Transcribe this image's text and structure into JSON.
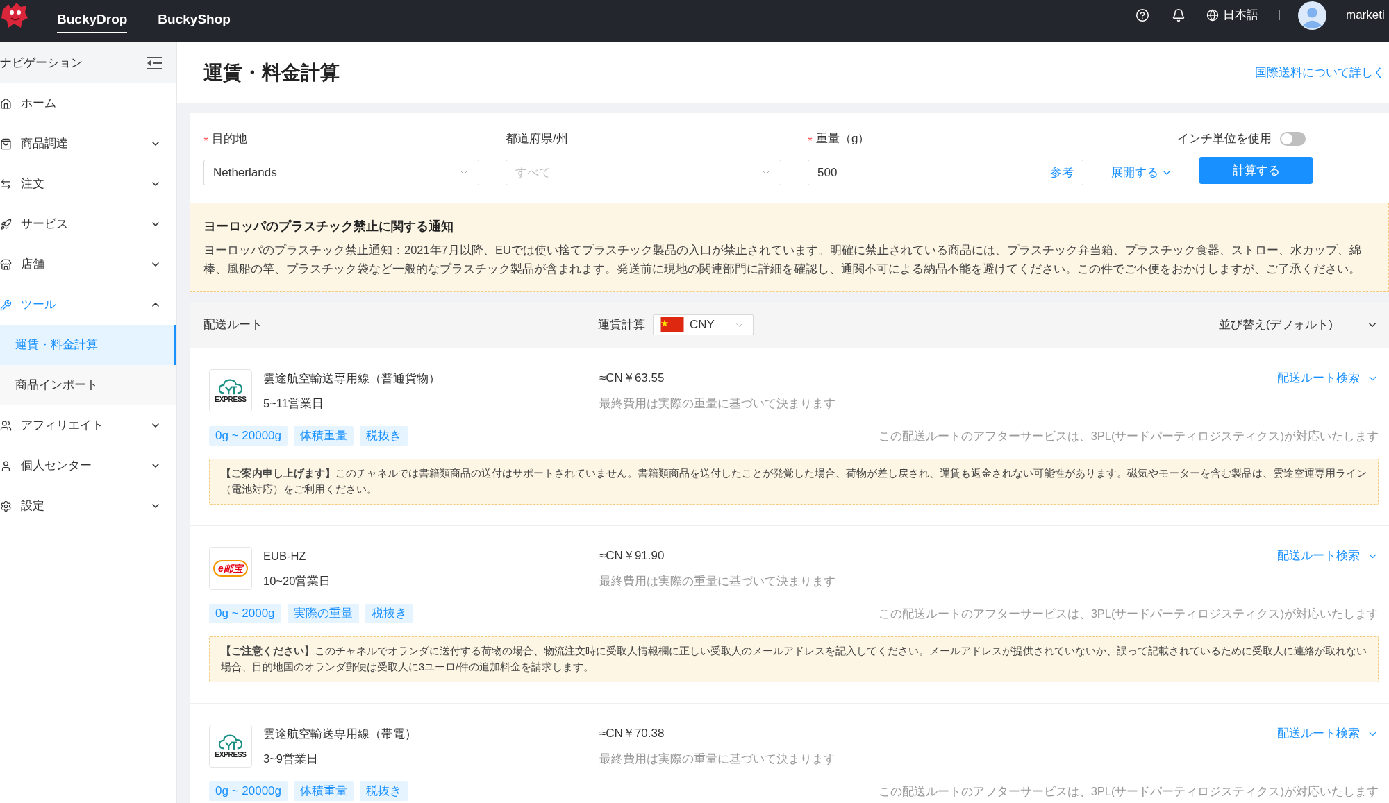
{
  "header": {
    "tabs": [
      {
        "label": "BuckyDrop",
        "selected": true
      },
      {
        "label": "BuckyShop",
        "selected": false
      }
    ],
    "language": "日本語",
    "user": "marketi"
  },
  "sidebar": {
    "title": "ナビゲーション",
    "items": [
      {
        "label": "ホーム",
        "selected": false
      },
      {
        "label": "商品調達",
        "selected": false,
        "expanded": false
      },
      {
        "label": "注文",
        "selected": false,
        "expanded": false
      },
      {
        "label": "サービス",
        "selected": false,
        "expanded": false
      },
      {
        "label": "店舗",
        "selected": false,
        "expanded": false
      },
      {
        "label": "ツール",
        "selected": false,
        "expanded": true,
        "children": [
          {
            "label": "運賃・料金計算",
            "selected": true
          },
          {
            "label": "商品インポート",
            "selected": false
          }
        ]
      },
      {
        "label": "アフィリエイト",
        "selected": false,
        "expanded": false
      },
      {
        "label": "個人センター",
        "selected": false,
        "expanded": false
      },
      {
        "label": "設定",
        "selected": false,
        "expanded": false
      }
    ]
  },
  "page": {
    "title": "運賃・料金計算",
    "help_link": "国際送料について詳しく"
  },
  "form": {
    "fields": [
      {
        "kind": "select",
        "label": "目的地",
        "required": true,
        "value": "Netherlands"
      },
      {
        "kind": "select",
        "label": "都道府県/州",
        "required": false,
        "placeholder": "すべて"
      },
      {
        "kind": "input",
        "label": "重量（g）",
        "required": true,
        "value": "500",
        "suffix": "参考"
      }
    ],
    "expand_link": "展開する",
    "inch_toggle": {
      "label": "インチ単位を使用",
      "on": false
    },
    "submit": "計算する"
  },
  "notice": {
    "title": "ヨーロッパのプラスチック禁止に関する通知",
    "body": "ヨーロッパのプラスチック禁止通知：2021年7月以降、EUでは使い捨てプラスチック製品の入口が禁止されています。明確に禁止されている商品には、プラスチック弁当箱、プラスチック食器、ストロー、水カップ、綿棒、風船の竿、プラスチック袋など一般的なプラスチック製品が含まれます。発送前に現地の関連部門に詳細を確認し、通関不可による納品不能を避けてください。この件でご不便をおかけしますが、ご了承ください。"
  },
  "routes_header": {
    "label": "配送ルート",
    "currency_label": "運賃計算",
    "currency": "CNY",
    "sort": "並び替え(デフォルト)"
  },
  "routes": [
    {
      "logo": {
        "kind": "cloud",
        "text": "EXPRESS"
      },
      "name": "雲途航空輸送専用線（普通貨物）",
      "days": "5~11営業日",
      "price": "≈CN￥63.55",
      "price_note": "最終費用は実際の重量に基づいて決まります",
      "search_link": "配送ルート検索",
      "tags": [
        "0g ~ 20000g",
        "体積重量",
        "税抜き"
      ],
      "after_service": "この配送ルートのアフターサービスは、3PL(サードパーティロジスティクス)が対応いたします",
      "notice": "**【ご案内申し上げます】**このチャネルでは書籍類商品の送付はサポートされていません。書籍類商品を送付したことが発覚した場合、荷物が差し戻され、運賃も返金されない可能性があります。磁気やモーターを含む製品は、雲途空運専用ライン（電池対応）をご利用ください。"
    },
    {
      "logo": {
        "kind": "eub",
        "text": "e邮宝"
      },
      "name": "EUB-HZ",
      "days": "10~20営業日",
      "price": "≈CN￥91.90",
      "price_note": "最終費用は実際の重量に基づいて決まります",
      "search_link": "配送ルート検索",
      "tags": [
        "0g ~ 2000g",
        "実際の重量",
        "税抜き"
      ],
      "after_service": "この配送ルートのアフターサービスは、3PL(サードパーティロジスティクス)が対応いたします",
      "notice": "**【ご注意ください】**このチャネルでオランダに送付する荷物の場合、物流注文時に受取人情報欄に正しい受取人のメールアドレスを記入してください。メールアドレスが提供されていないか、誤って記載されているために受取人に連絡が取れない場合、目的地国のオランダ郵便は受取人に3ユーロ/件の追加料金を請求します。"
    },
    {
      "logo": {
        "kind": "cloud",
        "text": "EXPRESS"
      },
      "name": "雲途航空輸送専用線（帯電）",
      "days": "3~9営業日",
      "price": "≈CN￥70.38",
      "price_note": "最終費用は実際の重量に基づいて決まります",
      "search_link": "配送ルート検索",
      "tags": [
        "0g ~ 20000g",
        "体積重量",
        "税抜き"
      ],
      "after_service": "この配送ルートのアフターサービスは、3PL(サードパーティロジスティクス)が対応いたします"
    }
  ]
}
